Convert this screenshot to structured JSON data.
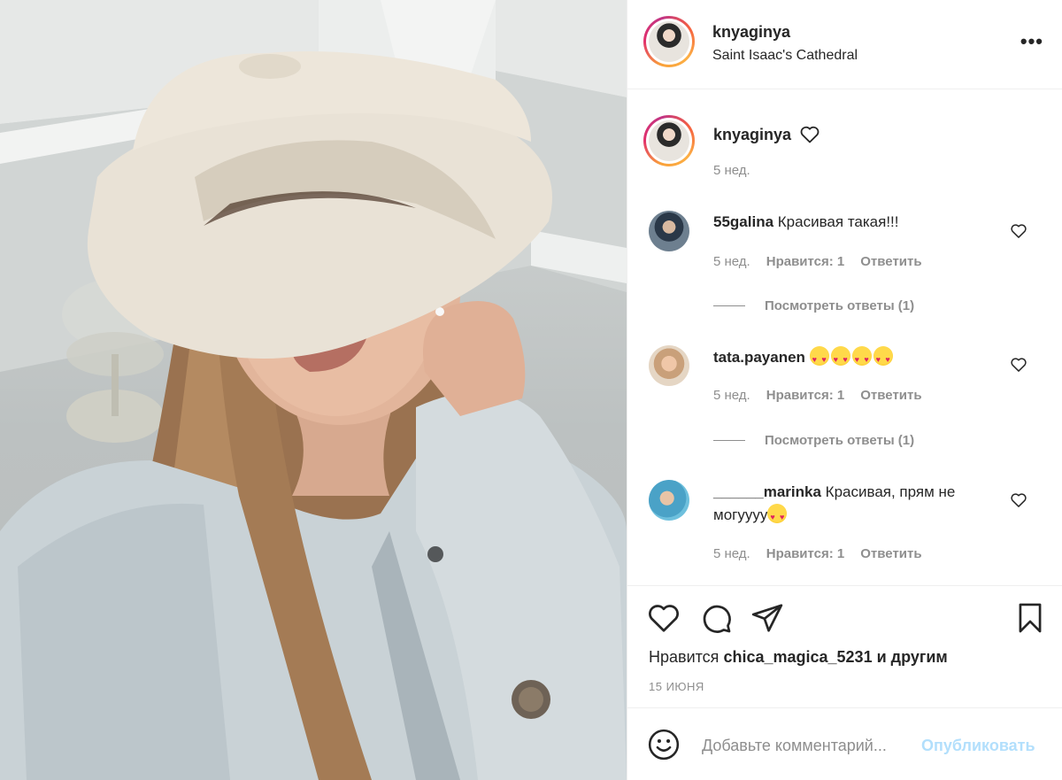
{
  "post": {
    "author": "knyaginya",
    "location": "Saint Isaac's Cathedral",
    "caption_time": "5 нед."
  },
  "comments": [
    {
      "user": "55galina",
      "text": "Красивая такая!!!",
      "time": "5 нед.",
      "likes": "Нравится: 1",
      "reply": "Ответить",
      "view_replies": "Посмотреть ответы (1)"
    },
    {
      "user": "tata.payanen",
      "text": "",
      "emoji_count": 4,
      "time": "5 нед.",
      "likes": "Нравится: 1",
      "reply": "Ответить",
      "view_replies": "Посмотреть ответы (1)"
    },
    {
      "user": "______marinka",
      "text": "Красивая, прям не могуууу",
      "time": "5 нед.",
      "likes": "Нравится: 1",
      "reply": "Ответить"
    }
  ],
  "footer": {
    "likes_prefix": "Нравится",
    "likes_user": "chica_magica_5231",
    "likes_suffix": "и другим",
    "date": "15 ИЮНЯ",
    "comment_placeholder": "Добавьте комментарий...",
    "publish": "Опубликовать"
  },
  "icons": {
    "more": "more-options-icon",
    "like": "heart-icon",
    "comment": "comment-icon",
    "share": "paper-plane-icon",
    "save": "bookmark-icon",
    "emoji": "smiley-icon"
  },
  "colors": {
    "text": "#262626",
    "muted": "#8e8e8e",
    "publish": "#b2dffc",
    "border": "#efefef"
  }
}
